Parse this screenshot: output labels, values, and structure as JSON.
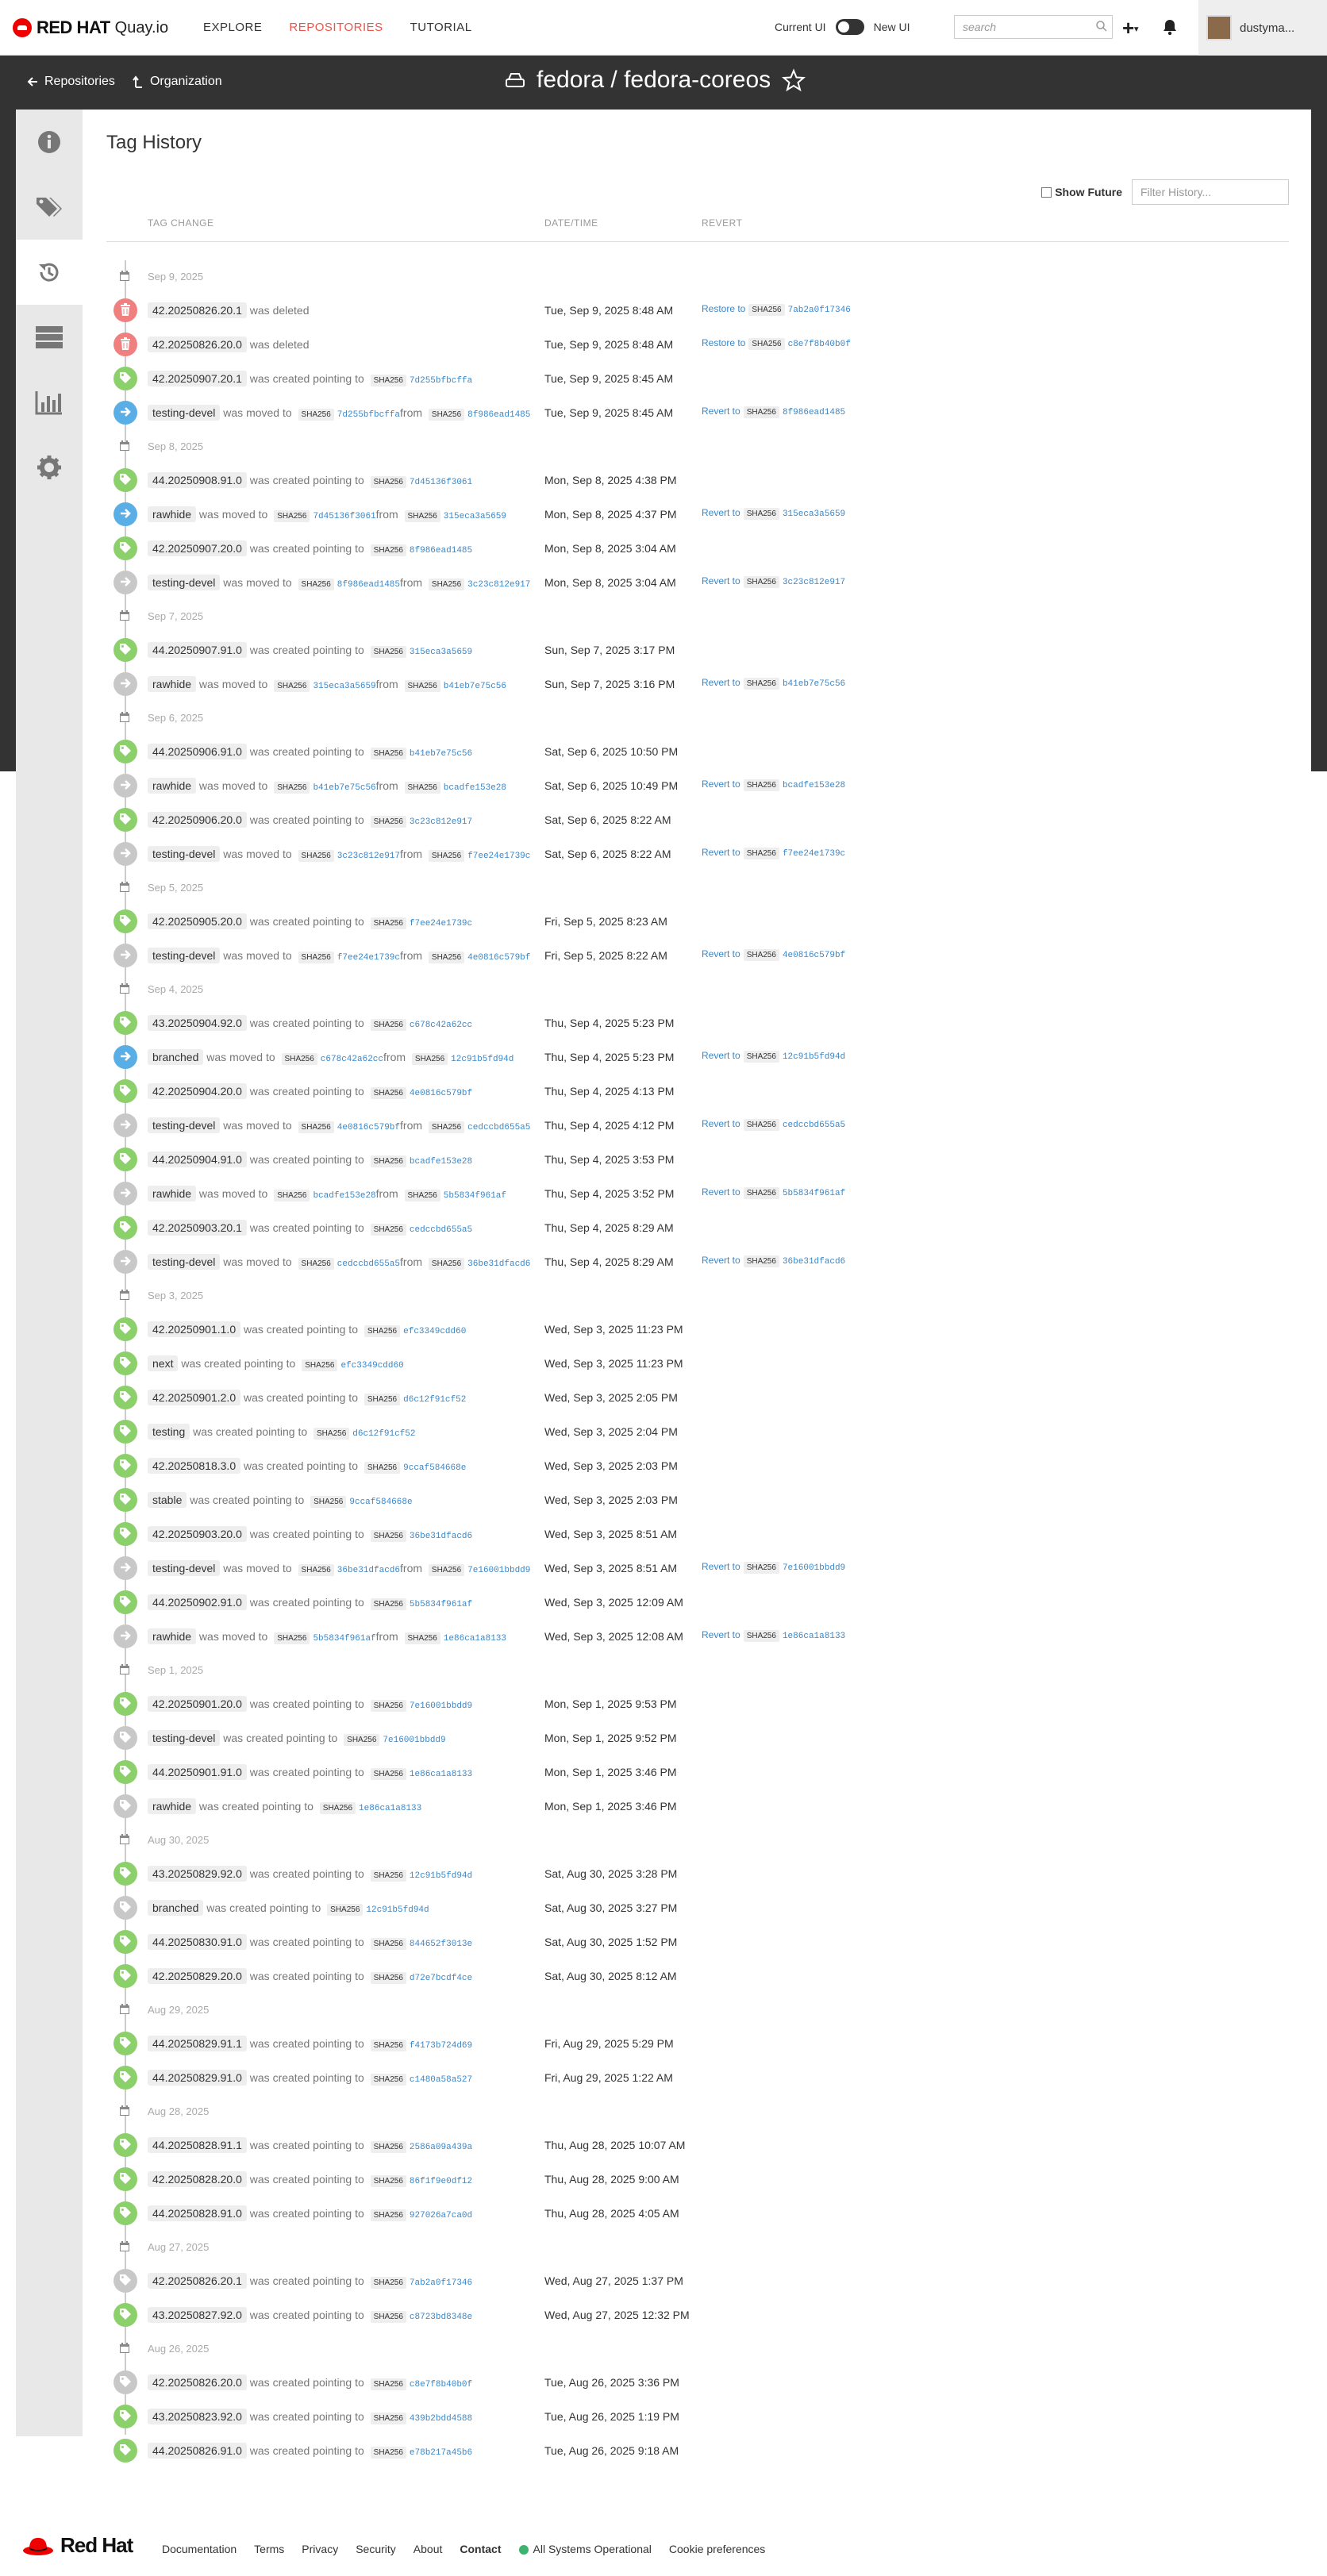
{
  "nav": {
    "brand": "RED HAT",
    "product": "Quay.io",
    "links": [
      "EXPLORE",
      "REPOSITORIES",
      "TUTORIAL"
    ],
    "current_ui_label": "Current UI",
    "new_ui_label": "New UI",
    "search_placeholder": "search",
    "username": "dustyma..."
  },
  "header": {
    "back_label": "Repositories",
    "org_label": "Organization",
    "repo_title": "fedora / fedora-coreos"
  },
  "page": {
    "title": "Tag History",
    "show_future_label": "Show Future",
    "filter_placeholder": "Filter History...",
    "col_change": "TAG CHANGE",
    "col_datetime": "DATE/TIME",
    "col_revert": "REVERT",
    "sha_label": "SHA256"
  },
  "history": [
    {
      "kind": "date",
      "text": "Sep 9, 2025"
    },
    {
      "kind": "event",
      "color": "red",
      "icon": "trash-icon",
      "tag": "42.20250826.20.1",
      "action": "was deleted",
      "dt": "Tue, Sep 9, 2025 8:48 AM",
      "revert_label": "Restore to",
      "revert_hash": "7ab2a0f17346"
    },
    {
      "kind": "event",
      "color": "red",
      "icon": "trash-icon",
      "tag": "42.20250826.20.0",
      "action": "was deleted",
      "dt": "Tue, Sep 9, 2025 8:48 AM",
      "revert_label": "Restore to",
      "revert_hash": "c8e7f8b40b0f"
    },
    {
      "kind": "event",
      "color": "green",
      "icon": "tag-icon",
      "tag": "42.20250907.20.1",
      "action": "was created pointing to",
      "hash1": "7d255bfbcffa",
      "dt": "Tue, Sep 9, 2025 8:45 AM"
    },
    {
      "kind": "event",
      "color": "blue",
      "icon": "arrow-right-icon",
      "tag": "testing-devel",
      "action": "was moved to",
      "hash1": "7d255bfbcffa",
      "from": "from",
      "hash2": "8f986ead1485",
      "dt": "Tue, Sep 9, 2025 8:45 AM",
      "revert_label": "Revert to",
      "revert_hash": "8f986ead1485"
    },
    {
      "kind": "date",
      "text": "Sep 8, 2025"
    },
    {
      "kind": "event",
      "color": "green",
      "icon": "tag-icon",
      "tag": "44.20250908.91.0",
      "action": "was created pointing to",
      "hash1": "7d45136f3061",
      "dt": "Mon, Sep 8, 2025 4:38 PM"
    },
    {
      "kind": "event",
      "color": "blue",
      "icon": "arrow-right-icon",
      "tag": "rawhide",
      "action": "was moved to",
      "hash1": "7d45136f3061",
      "from": "from",
      "hash2": "315eca3a5659",
      "dt": "Mon, Sep 8, 2025 4:37 PM",
      "revert_label": "Revert to",
      "revert_hash": "315eca3a5659"
    },
    {
      "kind": "event",
      "color": "green",
      "icon": "tag-icon",
      "tag": "42.20250907.20.0",
      "action": "was created pointing to",
      "hash1": "8f986ead1485",
      "dt": "Mon, Sep 8, 2025 3:04 AM"
    },
    {
      "kind": "event",
      "color": "gray",
      "icon": "arrow-right-icon",
      "tag": "testing-devel",
      "action": "was moved to",
      "hash1": "8f986ead1485",
      "from": "from",
      "hash2": "3c23c812e917",
      "dt": "Mon, Sep 8, 2025 3:04 AM",
      "revert_label": "Revert to",
      "revert_hash": "3c23c812e917"
    },
    {
      "kind": "date",
      "text": "Sep 7, 2025"
    },
    {
      "kind": "event",
      "color": "green",
      "icon": "tag-icon",
      "tag": "44.20250907.91.0",
      "action": "was created pointing to",
      "hash1": "315eca3a5659",
      "dt": "Sun, Sep 7, 2025 3:17 PM"
    },
    {
      "kind": "event",
      "color": "gray",
      "icon": "arrow-right-icon",
      "tag": "rawhide",
      "action": "was moved to",
      "hash1": "315eca3a5659",
      "from": "from",
      "hash2": "b41eb7e75c56",
      "dt": "Sun, Sep 7, 2025 3:16 PM",
      "revert_label": "Revert to",
      "revert_hash": "b41eb7e75c56"
    },
    {
      "kind": "date",
      "text": "Sep 6, 2025"
    },
    {
      "kind": "event",
      "color": "green",
      "icon": "tag-icon",
      "tag": "44.20250906.91.0",
      "action": "was created pointing to",
      "hash1": "b41eb7e75c56",
      "dt": "Sat, Sep 6, 2025 10:50 PM"
    },
    {
      "kind": "event",
      "color": "gray",
      "icon": "arrow-right-icon",
      "tag": "rawhide",
      "action": "was moved to",
      "hash1": "b41eb7e75c56",
      "from": "from",
      "hash2": "bcadfe153e28",
      "dt": "Sat, Sep 6, 2025 10:49 PM",
      "revert_label": "Revert to",
      "revert_hash": "bcadfe153e28"
    },
    {
      "kind": "event",
      "color": "green",
      "icon": "tag-icon",
      "tag": "42.20250906.20.0",
      "action": "was created pointing to",
      "hash1": "3c23c812e917",
      "dt": "Sat, Sep 6, 2025 8:22 AM"
    },
    {
      "kind": "event",
      "color": "gray",
      "icon": "arrow-right-icon",
      "tag": "testing-devel",
      "action": "was moved to",
      "hash1": "3c23c812e917",
      "from": "from",
      "hash2": "f7ee24e1739c",
      "dt": "Sat, Sep 6, 2025 8:22 AM",
      "revert_label": "Revert to",
      "revert_hash": "f7ee24e1739c"
    },
    {
      "kind": "date",
      "text": "Sep 5, 2025"
    },
    {
      "kind": "event",
      "color": "green",
      "icon": "tag-icon",
      "tag": "42.20250905.20.0",
      "action": "was created pointing to",
      "hash1": "f7ee24e1739c",
      "dt": "Fri, Sep 5, 2025 8:23 AM"
    },
    {
      "kind": "event",
      "color": "gray",
      "icon": "arrow-right-icon",
      "tag": "testing-devel",
      "action": "was moved to",
      "hash1": "f7ee24e1739c",
      "from": "from",
      "hash2": "4e0816c579bf",
      "dt": "Fri, Sep 5, 2025 8:22 AM",
      "revert_label": "Revert to",
      "revert_hash": "4e0816c579bf"
    },
    {
      "kind": "date",
      "text": "Sep 4, 2025"
    },
    {
      "kind": "event",
      "color": "green",
      "icon": "tag-icon",
      "tag": "43.20250904.92.0",
      "action": "was created pointing to",
      "hash1": "c678c42a62cc",
      "dt": "Thu, Sep 4, 2025 5:23 PM"
    },
    {
      "kind": "event",
      "color": "blue",
      "icon": "arrow-right-icon",
      "tag": "branched",
      "action": "was moved to",
      "hash1": "c678c42a62cc",
      "from": "from",
      "hash2": "12c91b5fd94d",
      "dt": "Thu, Sep 4, 2025 5:23 PM",
      "revert_label": "Revert to",
      "revert_hash": "12c91b5fd94d"
    },
    {
      "kind": "event",
      "color": "green",
      "icon": "tag-icon",
      "tag": "42.20250904.20.0",
      "action": "was created pointing to",
      "hash1": "4e0816c579bf",
      "dt": "Thu, Sep 4, 2025 4:13 PM"
    },
    {
      "kind": "event",
      "color": "gray",
      "icon": "arrow-right-icon",
      "tag": "testing-devel",
      "action": "was moved to",
      "hash1": "4e0816c579bf",
      "from": "from",
      "hash2": "cedccbd655a5",
      "dt": "Thu, Sep 4, 2025 4:12 PM",
      "revert_label": "Revert to",
      "revert_hash": "cedccbd655a5"
    },
    {
      "kind": "event",
      "color": "green",
      "icon": "tag-icon",
      "tag": "44.20250904.91.0",
      "action": "was created pointing to",
      "hash1": "bcadfe153e28",
      "dt": "Thu, Sep 4, 2025 3:53 PM"
    },
    {
      "kind": "event",
      "color": "gray",
      "icon": "arrow-right-icon",
      "tag": "rawhide",
      "action": "was moved to",
      "hash1": "bcadfe153e28",
      "from": "from",
      "hash2": "5b5834f961af",
      "dt": "Thu, Sep 4, 2025 3:52 PM",
      "revert_label": "Revert to",
      "revert_hash": "5b5834f961af"
    },
    {
      "kind": "event",
      "color": "green",
      "icon": "tag-icon",
      "tag": "42.20250903.20.1",
      "action": "was created pointing to",
      "hash1": "cedccbd655a5",
      "dt": "Thu, Sep 4, 2025 8:29 AM"
    },
    {
      "kind": "event",
      "color": "gray",
      "icon": "arrow-right-icon",
      "tag": "testing-devel",
      "action": "was moved to",
      "hash1": "cedccbd655a5",
      "from": "from",
      "hash2": "36be31dfacd6",
      "dt": "Thu, Sep 4, 2025 8:29 AM",
      "revert_label": "Revert to",
      "revert_hash": "36be31dfacd6"
    },
    {
      "kind": "date",
      "text": "Sep 3, 2025"
    },
    {
      "kind": "event",
      "color": "green",
      "icon": "tag-icon",
      "tag": "42.20250901.1.0",
      "action": "was created pointing to",
      "hash1": "efc3349cdd60",
      "dt": "Wed, Sep 3, 2025 11:23 PM"
    },
    {
      "kind": "event",
      "color": "green",
      "icon": "tag-icon",
      "tag": "next",
      "action": "was created pointing to",
      "hash1": "efc3349cdd60",
      "dt": "Wed, Sep 3, 2025 11:23 PM"
    },
    {
      "kind": "event",
      "color": "green",
      "icon": "tag-icon",
      "tag": "42.20250901.2.0",
      "action": "was created pointing to",
      "hash1": "d6c12f91cf52",
      "dt": "Wed, Sep 3, 2025 2:05 PM"
    },
    {
      "kind": "event",
      "color": "green",
      "icon": "tag-icon",
      "tag": "testing",
      "action": "was created pointing to",
      "hash1": "d6c12f91cf52",
      "dt": "Wed, Sep 3, 2025 2:04 PM"
    },
    {
      "kind": "event",
      "color": "green",
      "icon": "tag-icon",
      "tag": "42.20250818.3.0",
      "action": "was created pointing to",
      "hash1": "9ccaf584668e",
      "dt": "Wed, Sep 3, 2025 2:03 PM"
    },
    {
      "kind": "event",
      "color": "green",
      "icon": "tag-icon",
      "tag": "stable",
      "action": "was created pointing to",
      "hash1": "9ccaf584668e",
      "dt": "Wed, Sep 3, 2025 2:03 PM"
    },
    {
      "kind": "event",
      "color": "green",
      "icon": "tag-icon",
      "tag": "42.20250903.20.0",
      "action": "was created pointing to",
      "hash1": "36be31dfacd6",
      "dt": "Wed, Sep 3, 2025 8:51 AM"
    },
    {
      "kind": "event",
      "color": "gray",
      "icon": "arrow-right-icon",
      "tag": "testing-devel",
      "action": "was moved to",
      "hash1": "36be31dfacd6",
      "from": "from",
      "hash2": "7e16001bbdd9",
      "dt": "Wed, Sep 3, 2025 8:51 AM",
      "revert_label": "Revert to",
      "revert_hash": "7e16001bbdd9"
    },
    {
      "kind": "event",
      "color": "green",
      "icon": "tag-icon",
      "tag": "44.20250902.91.0",
      "action": "was created pointing to",
      "hash1": "5b5834f961af",
      "dt": "Wed, Sep 3, 2025 12:09 AM"
    },
    {
      "kind": "event",
      "color": "gray",
      "icon": "arrow-right-icon",
      "tag": "rawhide",
      "action": "was moved to",
      "hash1": "5b5834f961af",
      "from": "from",
      "hash2": "1e86ca1a8133",
      "dt": "Wed, Sep 3, 2025 12:08 AM",
      "revert_label": "Revert to",
      "revert_hash": "1e86ca1a8133"
    },
    {
      "kind": "date",
      "text": "Sep 1, 2025"
    },
    {
      "kind": "event",
      "color": "green",
      "icon": "tag-icon",
      "tag": "42.20250901.20.0",
      "action": "was created pointing to",
      "hash1": "7e16001bbdd9",
      "dt": "Mon, Sep 1, 2025 9:53 PM"
    },
    {
      "kind": "event",
      "color": "gray",
      "icon": "tag-icon",
      "tag": "testing-devel",
      "action": "was created pointing to",
      "hash1": "7e16001bbdd9",
      "dt": "Mon, Sep 1, 2025 9:52 PM"
    },
    {
      "kind": "event",
      "color": "green",
      "icon": "tag-icon",
      "tag": "44.20250901.91.0",
      "action": "was created pointing to",
      "hash1": "1e86ca1a8133",
      "dt": "Mon, Sep 1, 2025 3:46 PM"
    },
    {
      "kind": "event",
      "color": "gray",
      "icon": "tag-icon",
      "tag": "rawhide",
      "action": "was created pointing to",
      "hash1": "1e86ca1a8133",
      "dt": "Mon, Sep 1, 2025 3:46 PM"
    },
    {
      "kind": "date",
      "text": "Aug 30, 2025"
    },
    {
      "kind": "event",
      "color": "green",
      "icon": "tag-icon",
      "tag": "43.20250829.92.0",
      "action": "was created pointing to",
      "hash1": "12c91b5fd94d",
      "dt": "Sat, Aug 30, 2025 3:28 PM"
    },
    {
      "kind": "event",
      "color": "gray",
      "icon": "tag-icon",
      "tag": "branched",
      "action": "was created pointing to",
      "hash1": "12c91b5fd94d",
      "dt": "Sat, Aug 30, 2025 3:27 PM"
    },
    {
      "kind": "event",
      "color": "green",
      "icon": "tag-icon",
      "tag": "44.20250830.91.0",
      "action": "was created pointing to",
      "hash1": "844652f3013e",
      "dt": "Sat, Aug 30, 2025 1:52 PM"
    },
    {
      "kind": "event",
      "color": "green",
      "icon": "tag-icon",
      "tag": "42.20250829.20.0",
      "action": "was created pointing to",
      "hash1": "d72e7bcdf4ce",
      "dt": "Sat, Aug 30, 2025 8:12 AM"
    },
    {
      "kind": "date",
      "text": "Aug 29, 2025"
    },
    {
      "kind": "event",
      "color": "green",
      "icon": "tag-icon",
      "tag": "44.20250829.91.1",
      "action": "was created pointing to",
      "hash1": "f4173b724d69",
      "dt": "Fri, Aug 29, 2025 5:29 PM"
    },
    {
      "kind": "event",
      "color": "green",
      "icon": "tag-icon",
      "tag": "44.20250829.91.0",
      "action": "was created pointing to",
      "hash1": "c1480a58a527",
      "dt": "Fri, Aug 29, 2025 1:22 AM"
    },
    {
      "kind": "date",
      "text": "Aug 28, 2025"
    },
    {
      "kind": "event",
      "color": "green",
      "icon": "tag-icon",
      "tag": "44.20250828.91.1",
      "action": "was created pointing to",
      "hash1": "2586a09a439a",
      "dt": "Thu, Aug 28, 2025 10:07 AM"
    },
    {
      "kind": "event",
      "color": "green",
      "icon": "tag-icon",
      "tag": "42.20250828.20.0",
      "action": "was created pointing to",
      "hash1": "86f1f9e0df12",
      "dt": "Thu, Aug 28, 2025 9:00 AM"
    },
    {
      "kind": "event",
      "color": "green",
      "icon": "tag-icon",
      "tag": "44.20250828.91.0",
      "action": "was created pointing to",
      "hash1": "927026a7ca0d",
      "dt": "Thu, Aug 28, 2025 4:05 AM"
    },
    {
      "kind": "date",
      "text": "Aug 27, 2025"
    },
    {
      "kind": "event",
      "color": "gray",
      "icon": "tag-icon",
      "tag": "42.20250826.20.1",
      "action": "was created pointing to",
      "hash1": "7ab2a0f17346",
      "dt": "Wed, Aug 27, 2025 1:37 PM"
    },
    {
      "kind": "event",
      "color": "green",
      "icon": "tag-icon",
      "tag": "43.20250827.92.0",
      "action": "was created pointing to",
      "hash1": "c8723bd8348e",
      "dt": "Wed, Aug 27, 2025 12:32 PM"
    },
    {
      "kind": "date",
      "text": "Aug 26, 2025"
    },
    {
      "kind": "event",
      "color": "gray",
      "icon": "tag-icon",
      "tag": "42.20250826.20.0",
      "action": "was created pointing to",
      "hash1": "c8e7f8b40b0f",
      "dt": "Tue, Aug 26, 2025 3:36 PM"
    },
    {
      "kind": "event",
      "color": "green",
      "icon": "tag-icon",
      "tag": "43.20250823.92.0",
      "action": "was created pointing to",
      "hash1": "439b2bdd4588",
      "dt": "Tue, Aug 26, 2025 1:19 PM"
    },
    {
      "kind": "event",
      "color": "green",
      "icon": "tag-icon",
      "tag": "44.20250826.91.0",
      "action": "was created pointing to",
      "hash1": "e78b217a45b6",
      "dt": "Tue, Aug 26, 2025 9:18 AM"
    }
  ],
  "footer": {
    "brand": "Red Hat",
    "links": [
      "Documentation",
      "Terms",
      "Privacy",
      "Security",
      "About",
      "Contact"
    ],
    "status": "All Systems Operational",
    "cookie": "Cookie preferences"
  },
  "colors": {
    "accent": "#e9554b",
    "green": "#8bd06b",
    "red": "#f08080",
    "blue": "#5aaee6",
    "gray": "#c8c8c8",
    "link": "#3a87c8"
  }
}
